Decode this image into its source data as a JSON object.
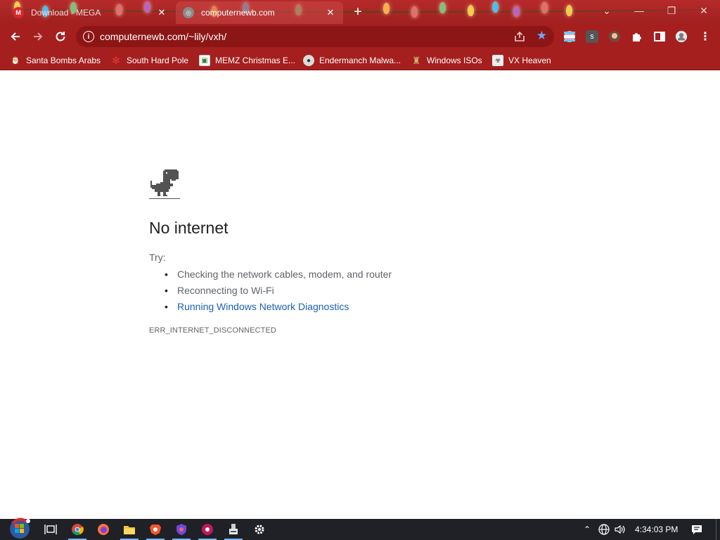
{
  "browser": {
    "tabs": [
      {
        "title": "Download - MEGA",
        "active": false
      },
      {
        "title": "computernewb.com",
        "active": true
      }
    ],
    "new_tab_symbol": "+",
    "window_controls": {
      "minimize": "—",
      "restore": "❐",
      "close": "✕",
      "tab_search": "⌄"
    },
    "url": "computernewb.com/~lily/vxh/",
    "extension_badge": "s"
  },
  "bookmarks": [
    {
      "label": "Santa Bombs Arabs",
      "icon": "santa-icon"
    },
    {
      "label": "South Hard Pole",
      "icon": "snowflake-icon"
    },
    {
      "label": "MEMZ Christmas E...",
      "icon": "memz-icon"
    },
    {
      "label": "Endermanch Malwa...",
      "icon": "raccoon-icon"
    },
    {
      "label": "Windows ISOs",
      "icon": "windows-iso-icon"
    },
    {
      "label": "VX Heaven",
      "icon": "vx-icon"
    }
  ],
  "page": {
    "title": "No internet",
    "try_label": "Try:",
    "suggestions": [
      "Checking the network cables, modem, and router",
      "Reconnecting to Wi-Fi",
      "Running Windows Network Diagnostics"
    ],
    "error_code": "ERR_INTERNET_DISCONNECTED"
  },
  "taskbar": {
    "clock": "4:34:03 PM",
    "apps": [
      "start-orb",
      "task-view",
      "chrome",
      "firefox",
      "file-explorer",
      "brave",
      "vpn",
      "app",
      "usb-tool",
      "settings"
    ]
  },
  "colors": {
    "frame": "#a51f1f",
    "link": "#1a5fb4",
    "taskbar": "#1f2127"
  }
}
